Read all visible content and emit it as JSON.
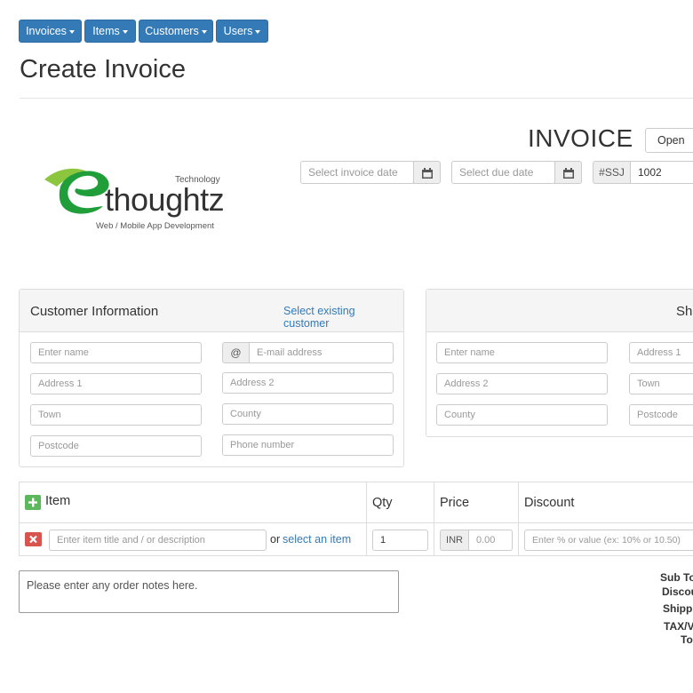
{
  "nav": {
    "invoices": "Invoices",
    "items": "Items",
    "customers": "Customers",
    "users": "Users"
  },
  "page_title": "Create Invoice",
  "logo": {
    "text_main": "thoughtz",
    "text_top": "Technology",
    "text_sub": "Web / Mobile App Development"
  },
  "invoice": {
    "heading": "INVOICE",
    "status": "Open",
    "invoice_date_placeholder": "Select invoice date",
    "due_date_placeholder": "Select due date",
    "prefix": "#SSJ",
    "number": "1002"
  },
  "customer": {
    "title": "Customer Information",
    "select_existing": "Select existing customer",
    "name_placeholder": "Enter name",
    "email_addon": "@",
    "email_placeholder": "E-mail address",
    "address1_placeholder": "Address 1",
    "address2_placeholder": "Address 2",
    "town_placeholder": "Town",
    "county_placeholder": "County",
    "postcode_placeholder": "Postcode",
    "phone_placeholder": "Phone number"
  },
  "shipping": {
    "title_partial": "Shi",
    "name_placeholder": "Enter name",
    "address1_placeholder": "Address 1",
    "address2_placeholder": "Address 2",
    "town_placeholder": "Town",
    "county_placeholder": "County",
    "postcode_placeholder": "Postcode"
  },
  "items_table": {
    "col_item": "Item",
    "col_qty": "Qty",
    "col_price": "Price",
    "col_discount": "Discount",
    "row": {
      "item_placeholder": "Enter item title and / or description",
      "or_text": "or",
      "select_item": "select an item",
      "qty": "1",
      "currency": "INR",
      "price_placeholder": "0.00",
      "discount_placeholder": "Enter % or value (ex: 10% or 10.50)"
    }
  },
  "notes_placeholder": "Please enter any order notes here.",
  "totals": {
    "subtotal": "Sub To",
    "discount": "Discou",
    "shipping": "Shippi",
    "tax": "TAX/V",
    "total": "To"
  },
  "colors": {
    "primary": "#337ab7",
    "success": "#5cb85c",
    "danger": "#d9534f"
  }
}
